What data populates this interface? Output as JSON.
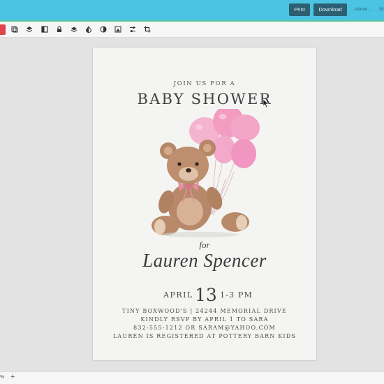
{
  "header": {
    "print_label": "Print",
    "download_label": "Download",
    "user_label": "Admin",
    "truncated_label": "Sh"
  },
  "toolbar": {
    "tools": [
      "copy-icon",
      "layers-icon",
      "book-icon",
      "lock-icon",
      "stack-icon",
      "contrast-icon",
      "color-icon",
      "image-icon",
      "sliders-icon",
      "crop-icon"
    ]
  },
  "invitation": {
    "intro": "JOIN US FOR A",
    "title": "BABY SHOWER",
    "for_label": "for",
    "honoree": "Lauren Spencer",
    "month": "APRIL",
    "day": "13",
    "time": "1-3 PM",
    "details": [
      "TINY BOXWOOD'S | 24244 MEMORIAL DRIVE",
      "KINDLY RSVP BY APRIL 1 TO SARA",
      "832-555-1212 OR SARAM@YAHOO.COM",
      "LAUREN IS REGISTERED AT POTTERY BARN KIDS"
    ]
  },
  "footer": {
    "zoom_label": "%",
    "zoom_in_label": "+"
  },
  "colors": {
    "header_bg": "#4bc3e3",
    "button_bg": "#2c5f72",
    "accent_line": "#58c99a",
    "tool_red": "#e0434d",
    "balloon_pink": "#f2a7c8",
    "bear_brown": "#b88a6a"
  }
}
